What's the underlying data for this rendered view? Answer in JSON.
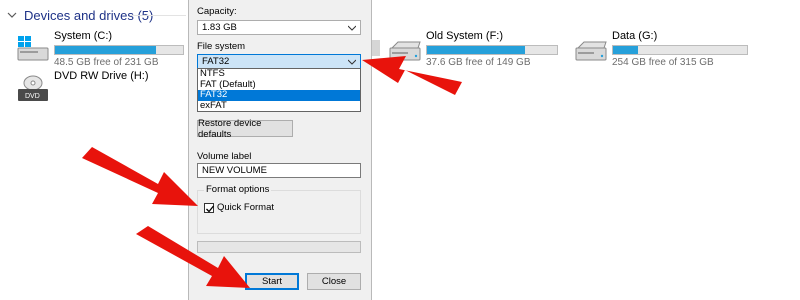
{
  "explorer": {
    "group_title": "Devices and drives (5)",
    "drives": [
      {
        "name": "System (C:)",
        "free_text": "48.5 GB free of 231 GB",
        "used_fraction": 0.79,
        "icon": "windows-drive-icon"
      },
      {
        "name": "DVD RW Drive (H:)",
        "free_text": "",
        "used_fraction": null,
        "icon": "dvd-drive-icon"
      },
      {
        "name": "Old System (F:)",
        "free_text": "37.6 GB free of 149 GB",
        "used_fraction": 0.75,
        "icon": "hard-drive-icon"
      },
      {
        "name": "Data (G:)",
        "free_text": "254 GB free of 315 GB",
        "used_fraction": 0.19,
        "icon": "hard-drive-icon"
      }
    ]
  },
  "format_dialog": {
    "capacity_label": "Capacity:",
    "capacity_value": "1.83 GB",
    "file_system_label": "File system",
    "file_system_value": "FAT32",
    "file_system_options": [
      "NTFS",
      "FAT (Default)",
      "FAT32",
      "exFAT"
    ],
    "file_system_selected_index": 2,
    "restore_defaults_label": "Restore device defaults",
    "volume_label_label": "Volume label",
    "volume_label_value": "NEW VOLUME",
    "format_options_label": "Format options",
    "quick_format_label": "Quick Format",
    "quick_format_checked": true,
    "progress_fraction": 0,
    "start_label": "Start",
    "close_label": "Close"
  },
  "colors": {
    "accent": "#0078d7",
    "drive_bar": "#26a0da",
    "annotation_arrow": "#e8130c",
    "group_header": "#1e3287"
  }
}
